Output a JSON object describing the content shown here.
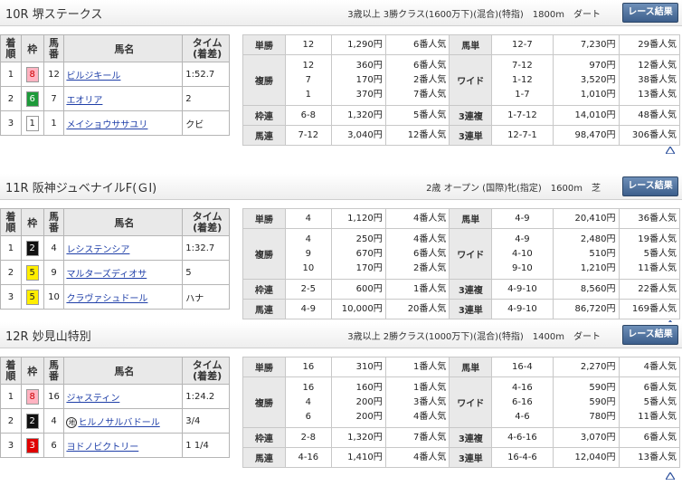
{
  "headers": {
    "rank": "着順",
    "frame": "枠",
    "num": "馬番",
    "name": "馬名",
    "time_top": "タイム",
    "time_bottom": "(着差)"
  },
  "result_button": "レース結果",
  "races": [
    {
      "title": "10R 堺ステークス",
      "cond": "3歳以上 3勝クラス(1600万下)(混合)(特指)",
      "dist": "1800m",
      "surface": "ダート",
      "results": [
        {
          "rank": "1",
          "frame": "8",
          "frame_bg": "#ffb3c1",
          "frame_fg": "#cc0000",
          "num": "12",
          "name": "ビルジキール",
          "time": "1:52.7",
          "mark": ""
        },
        {
          "rank": "2",
          "frame": "6",
          "frame_bg": "#1e9a3a",
          "frame_fg": "#ffffff",
          "num": "7",
          "name": "エオリア",
          "time": "2",
          "mark": ""
        },
        {
          "rank": "3",
          "frame": "1",
          "frame_bg": "#ffffff",
          "frame_fg": "#222222",
          "num": "1",
          "name": "メイショウササユリ",
          "time": "クビ",
          "mark": ""
        }
      ],
      "payouts": {
        "tansho": {
          "label": "単勝",
          "combo": [
            "12"
          ],
          "amount": [
            "1,290円"
          ],
          "pop": [
            "6番人気"
          ]
        },
        "fukusho": {
          "label": "複勝",
          "combo": [
            "12",
            "7",
            "1"
          ],
          "amount": [
            "360円",
            "170円",
            "370円"
          ],
          "pop": [
            "6番人気",
            "2番人気",
            "7番人気"
          ]
        },
        "wakuren": {
          "label": "枠連",
          "combo": [
            "6-8"
          ],
          "amount": [
            "1,320円"
          ],
          "pop": [
            "5番人気"
          ]
        },
        "umaren": {
          "label": "馬連",
          "combo": [
            "7-12"
          ],
          "amount": [
            "3,040円"
          ],
          "pop": [
            "12番人気"
          ]
        },
        "umatan": {
          "label": "馬単",
          "combo": [
            "12-7"
          ],
          "amount": [
            "7,230円"
          ],
          "pop": [
            "29番人気"
          ]
        },
        "wide": {
          "label": "ワイド",
          "combo": [
            "7-12",
            "1-12",
            "1-7"
          ],
          "amount": [
            "970円",
            "3,520円",
            "1,010円"
          ],
          "pop": [
            "12番人気",
            "38番人気",
            "13番人気"
          ]
        },
        "sanrenpuku": {
          "label": "3連複",
          "combo": [
            "1-7-12"
          ],
          "amount": [
            "14,010円"
          ],
          "pop": [
            "48番人気"
          ]
        },
        "sanrentan": {
          "label": "3連単",
          "combo": [
            "12-7-1"
          ],
          "amount": [
            "98,470円"
          ],
          "pop": [
            "306番人気"
          ]
        }
      }
    },
    {
      "title": "11R 阪神ジュベナイルF(ＧⅠ)",
      "cond": "2歳 オープン (国際)牝(指定)",
      "dist": "1600m",
      "surface": "芝",
      "results": [
        {
          "rank": "1",
          "frame": "2",
          "frame_bg": "#111111",
          "frame_fg": "#ffffff",
          "num": "4",
          "name": "レシステンシア",
          "time": "1:32.7",
          "mark": ""
        },
        {
          "rank": "2",
          "frame": "5",
          "frame_bg": "#ffee00",
          "frame_fg": "#222222",
          "num": "9",
          "name": "マルターズディオサ",
          "time": "5",
          "mark": ""
        },
        {
          "rank": "3",
          "frame": "5",
          "frame_bg": "#ffee00",
          "frame_fg": "#222222",
          "num": "10",
          "name": "クラヴァシュドール",
          "time": "ハナ",
          "mark": ""
        }
      ],
      "payouts": {
        "tansho": {
          "label": "単勝",
          "combo": [
            "4"
          ],
          "amount": [
            "1,120円"
          ],
          "pop": [
            "4番人気"
          ]
        },
        "fukusho": {
          "label": "複勝",
          "combo": [
            "4",
            "9",
            "10"
          ],
          "amount": [
            "250円",
            "670円",
            "170円"
          ],
          "pop": [
            "4番人気",
            "6番人気",
            "2番人気"
          ]
        },
        "wakuren": {
          "label": "枠連",
          "combo": [
            "2-5"
          ],
          "amount": [
            "600円"
          ],
          "pop": [
            "1番人気"
          ]
        },
        "umaren": {
          "label": "馬連",
          "combo": [
            "4-9"
          ],
          "amount": [
            "10,000円"
          ],
          "pop": [
            "20番人気"
          ]
        },
        "umatan": {
          "label": "馬単",
          "combo": [
            "4-9"
          ],
          "amount": [
            "20,410円"
          ],
          "pop": [
            "36番人気"
          ]
        },
        "wide": {
          "label": "ワイド",
          "combo": [
            "4-9",
            "4-10",
            "9-10"
          ],
          "amount": [
            "2,480円",
            "510円",
            "1,210円"
          ],
          "pop": [
            "19番人気",
            "5番人気",
            "11番人気"
          ]
        },
        "sanrenpuku": {
          "label": "3連複",
          "combo": [
            "4-9-10"
          ],
          "amount": [
            "8,560円"
          ],
          "pop": [
            "22番人気"
          ]
        },
        "sanrentan": {
          "label": "3連単",
          "combo": [
            "4-9-10"
          ],
          "amount": [
            "86,720円"
          ],
          "pop": [
            "169番人気"
          ]
        }
      }
    },
    {
      "title": "12R 妙見山特別",
      "cond": "3歳以上 2勝クラス(1000万下)(混合)(特指)",
      "dist": "1400m",
      "surface": "ダート",
      "results": [
        {
          "rank": "1",
          "frame": "8",
          "frame_bg": "#ffb3c1",
          "frame_fg": "#cc0000",
          "num": "16",
          "name": "ジャスティン",
          "time": "1:24.2",
          "mark": ""
        },
        {
          "rank": "2",
          "frame": "2",
          "frame_bg": "#111111",
          "frame_fg": "#ffffff",
          "num": "4",
          "name": "ヒルノサルバドール",
          "time": "3/4",
          "mark": "地"
        },
        {
          "rank": "3",
          "frame": "3",
          "frame_bg": "#e00000",
          "frame_fg": "#ffffff",
          "num": "6",
          "name": "ヨドノビクトリー",
          "time": "1 1/4",
          "mark": ""
        }
      ],
      "payouts": {
        "tansho": {
          "label": "単勝",
          "combo": [
            "16"
          ],
          "amount": [
            "310円"
          ],
          "pop": [
            "1番人気"
          ]
        },
        "fukusho": {
          "label": "複勝",
          "combo": [
            "16",
            "4",
            "6"
          ],
          "amount": [
            "160円",
            "200円",
            "200円"
          ],
          "pop": [
            "1番人気",
            "3番人気",
            "4番人気"
          ]
        },
        "wakuren": {
          "label": "枠連",
          "combo": [
            "2-8"
          ],
          "amount": [
            "1,320円"
          ],
          "pop": [
            "7番人気"
          ]
        },
        "umaren": {
          "label": "馬連",
          "combo": [
            "4-16"
          ],
          "amount": [
            "1,410円"
          ],
          "pop": [
            "4番人気"
          ]
        },
        "umatan": {
          "label": "馬単",
          "combo": [
            "16-4"
          ],
          "amount": [
            "2,270円"
          ],
          "pop": [
            "4番人気"
          ]
        },
        "wide": {
          "label": "ワイド",
          "combo": [
            "4-16",
            "6-16",
            "4-6"
          ],
          "amount": [
            "590円",
            "590円",
            "780円"
          ],
          "pop": [
            "6番人気",
            "5番人気",
            "11番人気"
          ]
        },
        "sanrenpuku": {
          "label": "3連複",
          "combo": [
            "4-6-16"
          ],
          "amount": [
            "3,070円"
          ],
          "pop": [
            "6番人気"
          ]
        },
        "sanrentan": {
          "label": "3連単",
          "combo": [
            "16-4-6"
          ],
          "amount": [
            "12,040円"
          ],
          "pop": [
            "13番人気"
          ]
        }
      }
    }
  ]
}
